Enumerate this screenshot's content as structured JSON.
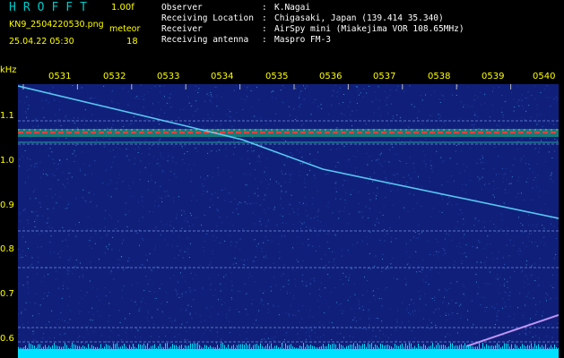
{
  "header": {
    "app_title": "HROFFT",
    "version": "1.00f",
    "filename": "KN9_2504220530.png",
    "meteor_label": "meteor",
    "datetime": "25.04.22 05:30",
    "meteor_count": "18",
    "info": [
      {
        "label": "Observer",
        "value": "K.Nagai"
      },
      {
        "label": "Receiving Location",
        "value": "Chigasaki, Japan (139.414 35.340)"
      },
      {
        "label": "Receiver",
        "value": "AirSpy mini (Miakejima VOR 108.65MHz)"
      },
      {
        "label": "Receiving antenna",
        "value": "Maspro FM-3"
      }
    ]
  },
  "spectrogram": {
    "y_unit": "kHz",
    "y_ticks": [
      "1.1",
      "1.0",
      "0.9",
      "0.8",
      "0.7",
      "0.6"
    ],
    "x_ticks": [
      "0531",
      "0532",
      "0533",
      "0534",
      "0535",
      "0536",
      "0537",
      "0538",
      "0539",
      "0540"
    ],
    "colors": {
      "background": "#10207a",
      "text": "#ffff00",
      "title": "#00c8c8",
      "carrier": "#ff4040",
      "trace": "#60d8ff",
      "floor": "#00e0ff"
    }
  }
}
